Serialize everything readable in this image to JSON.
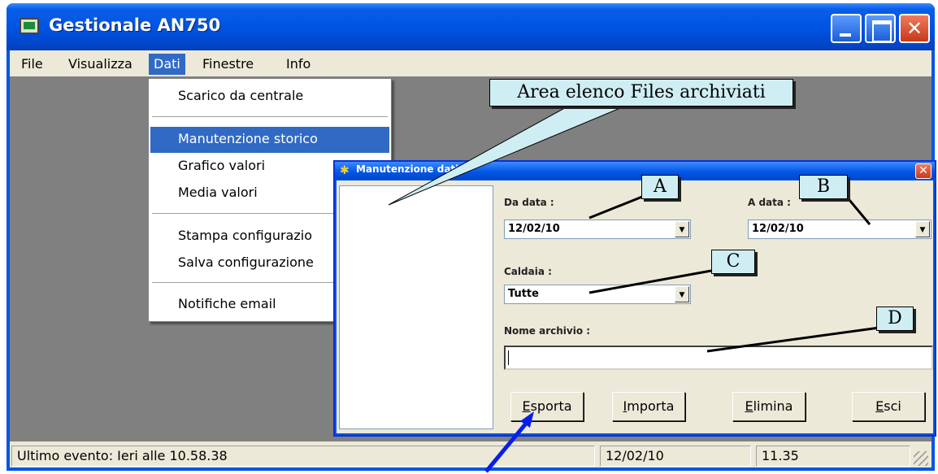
{
  "window": {
    "title": "Gestionale AN750"
  },
  "menu": [
    "File",
    "Visualizza",
    "Dati",
    "Finestre",
    "Info"
  ],
  "dropdown": {
    "items": [
      "Scarico da centrale",
      "Manutenzione storico",
      "Grafico valori",
      "Media valori",
      "Stampa configurazio",
      "Salva configurazione",
      "Notifiche email"
    ],
    "selected": "Manutenzione storico"
  },
  "status": {
    "event": "Ultimo evento: Ieri alle 10.58.38",
    "date": "12/02/10",
    "time": "11.35"
  },
  "dialog": {
    "title": "Manutenzione dati",
    "da_data_label": "Da data :",
    "da_data_value": "12/02/10",
    "a_data_label": "A data :",
    "a_data_value": "12/02/10",
    "caldaia_label": "Caldaia :",
    "caldaia_value": "Tutte",
    "nome_label": "Nome archivio :",
    "nome_value": "",
    "buttons": [
      {
        "accel": "E",
        "rest": "sporta"
      },
      {
        "accel": "I",
        "rest": "mporta"
      },
      {
        "accel": "E",
        "rest": "limina"
      },
      {
        "accel": "E",
        "rest": "sci"
      }
    ]
  },
  "callouts": {
    "area": "Area elenco Files archiviati",
    "a": "A",
    "b": "B",
    "c": "C",
    "d": "D"
  }
}
